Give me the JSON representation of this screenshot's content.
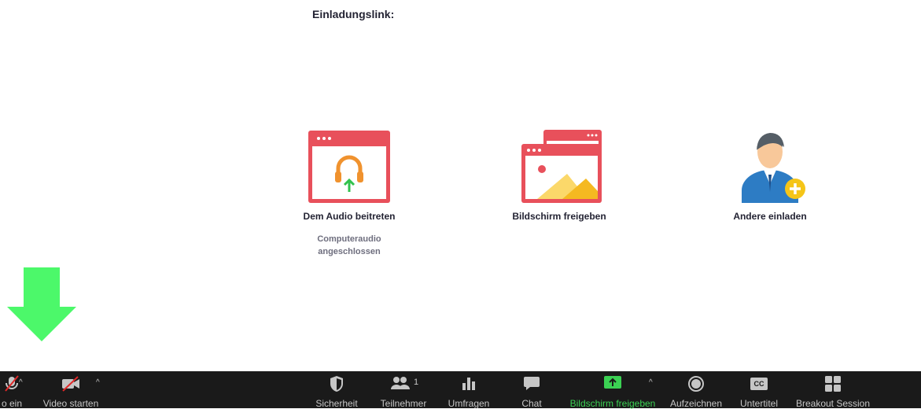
{
  "invite": {
    "label": "Einladungslink:"
  },
  "actions": [
    {
      "title": "Dem Audio beitreten",
      "sub": "Computeraudio angeschlossen"
    },
    {
      "title": "Bildschirm freigeben"
    },
    {
      "title": "Andere einladen"
    }
  ],
  "toolbar": {
    "audio": "o ein",
    "video": "Video starten",
    "security": "Sicherheit",
    "participants": "Teilnehmer",
    "participants_count": "1",
    "polls": "Umfragen",
    "chat": "Chat",
    "share": "Bildschirm freigeben",
    "record": "Aufzeichnen",
    "captions": "Untertitel",
    "captions_icon_text": "CC",
    "breakout": "Breakout Session"
  },
  "colors": {
    "toolbar_bg": "#1a1a1a",
    "share_green": "#3bd153",
    "arrow_green": "#4cf86a",
    "card_red": "#e8505b"
  }
}
